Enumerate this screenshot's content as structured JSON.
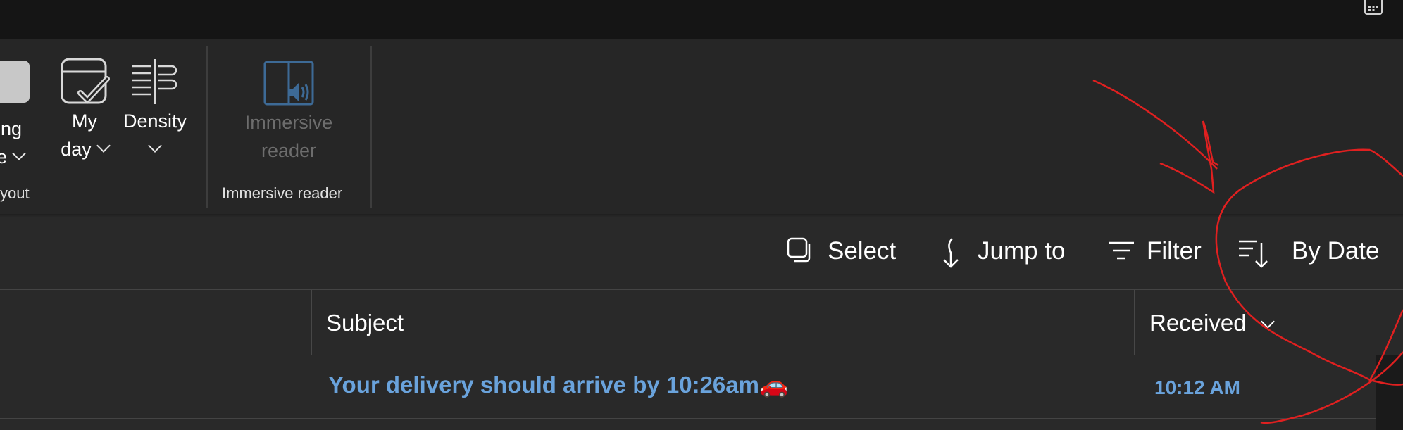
{
  "ribbon": {
    "reading_pane": {
      "line1": "ding",
      "line2": "ne"
    },
    "my_day": {
      "line1": "My",
      "line2": "day"
    },
    "density": {
      "line1": "Density"
    },
    "layout_group": "yout",
    "immersive": {
      "line1": "Immersive",
      "line2": "reader",
      "group": "Immersive reader"
    }
  },
  "commands": {
    "select": "Select",
    "jump_to": "Jump to",
    "filter": "Filter",
    "sort": "By Date"
  },
  "columns": {
    "subject": "Subject",
    "received": "Received"
  },
  "messages": [
    {
      "subject": "Your delivery should arrive by 10:26am🚗",
      "received": "10:12 AM"
    }
  ],
  "colors": {
    "unread_accent": "#6aa3dc",
    "annotation": "#e02020",
    "immersive_icon": "#3d6a96"
  }
}
